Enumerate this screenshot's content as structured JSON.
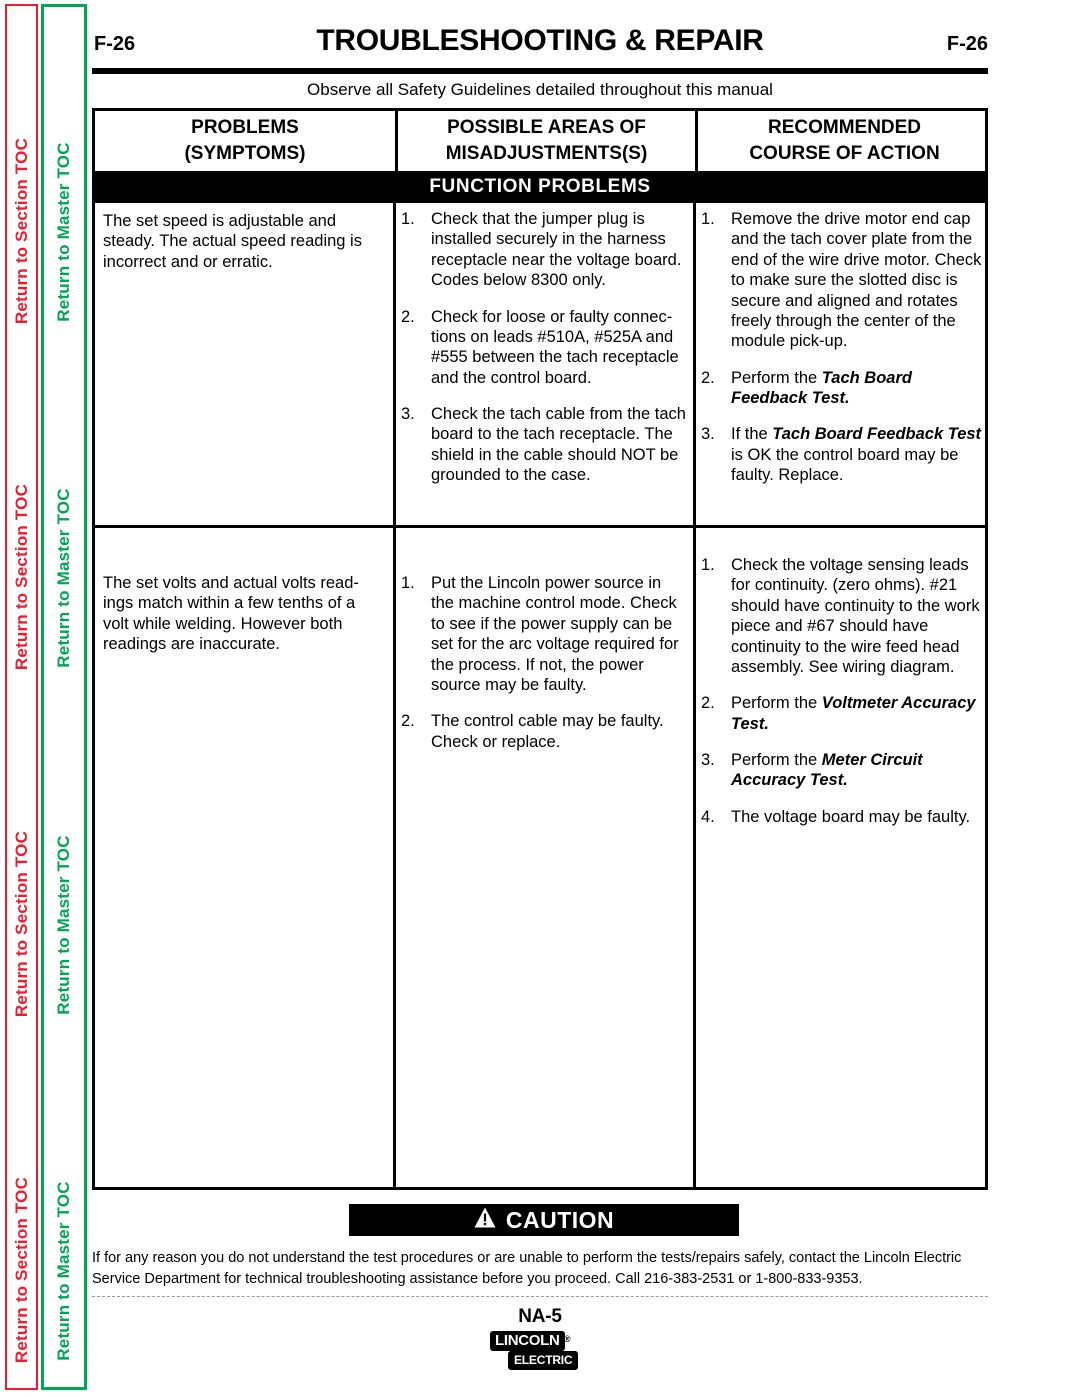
{
  "sidebar": {
    "section_toc_label": "Return to Section TOC",
    "master_toc_label": "Return to Master TOC",
    "section_toc_color": "#ed1c2e",
    "master_toc_color": "#00a651",
    "repeat_count": 4
  },
  "header": {
    "page_code_left": "F-26",
    "page_code_right": "F-26",
    "title": "TROUBLESHOOTING & REPAIR",
    "subtitle": "Observe all Safety Guidelines detailed throughout this manual"
  },
  "table": {
    "columns": [
      {
        "line1": "PROBLEMS",
        "line2": "(SYMPTOMS)"
      },
      {
        "line1": "POSSIBLE AREAS OF",
        "line2": "MISADJUSTMENTS(S)"
      },
      {
        "line1": "RECOMMENDED",
        "line2": "COURSE OF ACTION"
      }
    ],
    "band_label": "FUNCTION  PROBLEMS",
    "rows": [
      {
        "symptom": "The set speed is adjustable and steady.  The actual speed reading is incorrect and or erratic.",
        "areas": [
          {
            "num": "1.",
            "text": "Check that the jumper plug is installed securely in the harness receptacle near the voltage board.  Codes below 8300 only."
          },
          {
            "num": "2.",
            "text": "Check for loose or faulty connec-tions on leads #510A, #525A  and #555 between the tach receptacle and the control board."
          },
          {
            "num": "3.",
            "text": "Check the tach cable from the tach board to the tach receptacle. The shield in the cable should NOT be grounded to the case."
          }
        ],
        "actions": [
          {
            "num": "1.",
            "pre": "Remove the drive motor end cap and the tach cover plate from the end of the wire drive motor. Check to make sure the slotted disc is secure and aligned and rotates freely through the center of the module pick-up.",
            "bold": "",
            "post": ""
          },
          {
            "num": "2.",
            "pre": "Perform the ",
            "bold": "Tach Board Feedback Test.",
            "post": ""
          },
          {
            "num": "3.",
            "pre": "If the ",
            "bold": "Tach Board Feedback Test",
            "post": "  is OK the control board may be faulty.  Replace."
          }
        ]
      },
      {
        "symptom": "The set volts and actual volts read-ings match within a few tenths of a volt while welding.  However both readings are inaccurate.",
        "areas": [
          {
            "num": "1.",
            "text": "Put the Lincoln power source in the machine control mode. Check to see if the power supply can be set for the arc voltage required for the process.  If not, the power source may be faulty."
          },
          {
            "num": "2.",
            "text": "The control cable may be faulty. Check or replace."
          }
        ],
        "actions": [
          {
            "num": "1.",
            "pre": "Check the voltage sensing leads for continuity.  (zero ohms).  #21 should have continuity to the work piece and #67 should have continuity to the wire feed head assembly.  See wiring diagram.",
            "bold": "",
            "post": ""
          },
          {
            "num": "2.",
            "pre": "Perform the ",
            "bold": "Voltmeter Accuracy Test.",
            "post": ""
          },
          {
            "num": "3.",
            "pre": "Perform the ",
            "bold": "Meter Circuit Accuracy Test.",
            "post": ""
          },
          {
            "num": "4.",
            "pre": "The voltage board may be faulty.",
            "bold": "",
            "post": ""
          }
        ]
      }
    ]
  },
  "caution": {
    "label": "CAUTION",
    "icon": "warning-triangle-icon",
    "body": "If for any reason you do not understand the test procedures or are unable to perform the tests/repairs safely, contact the Lincoln Electric Service Department for technical troubleshooting assistance before you proceed. Call 216-383-2531 or 1-800-833-9353."
  },
  "footer": {
    "page_code": "NA-5",
    "logo_primary": "LINCOLN",
    "logo_registered": "®",
    "logo_secondary": "ELECTRIC"
  }
}
